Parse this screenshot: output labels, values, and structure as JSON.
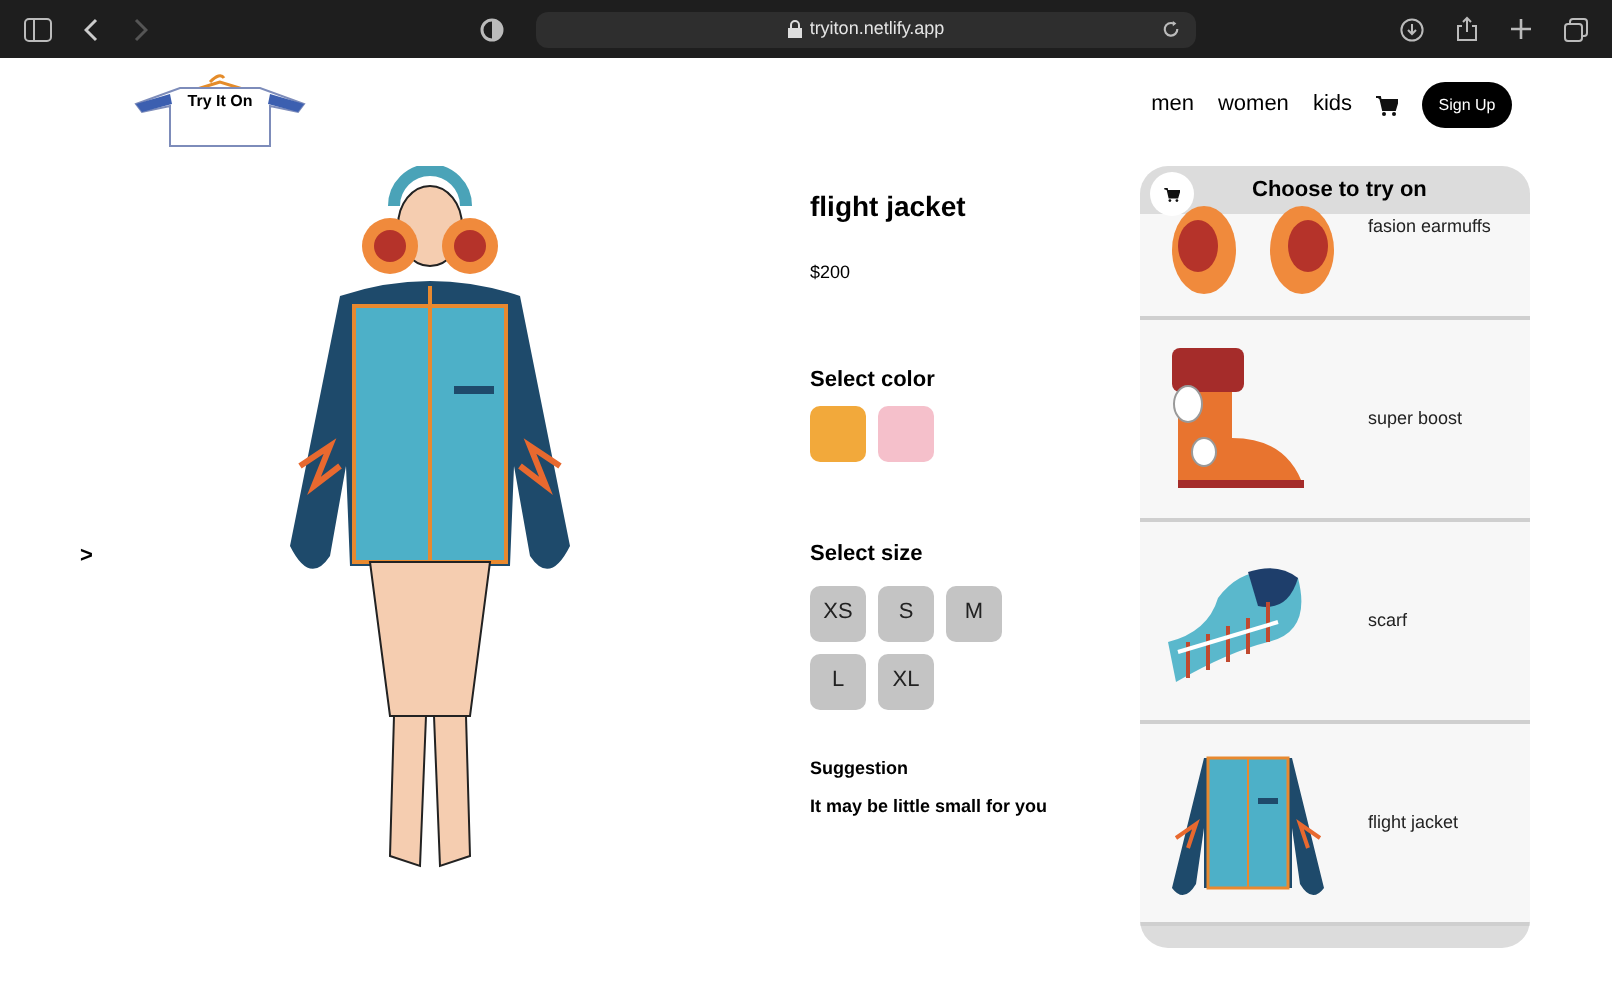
{
  "browser": {
    "url": "tryiton.netlify.app"
  },
  "logo": {
    "text": "Try It On"
  },
  "nav": {
    "links": [
      "men",
      "women",
      "kids"
    ],
    "signup": "Sign Up"
  },
  "carousel": {
    "next": ">"
  },
  "product": {
    "title": "flight jacket",
    "price": "$200",
    "color_heading": "Select color",
    "colors": [
      {
        "color": "#f2a93b"
      },
      {
        "color": "#f5c0cb"
      }
    ],
    "size_heading": "Select size",
    "sizes": [
      "XS",
      "S",
      "M",
      "L",
      "XL"
    ],
    "suggestion_heading": "Suggestion",
    "suggestion": "It may be little small for you"
  },
  "try_on_panel": {
    "title": "Choose to try on",
    "items": [
      {
        "kind": "earmuffs",
        "name": "fasion earmuffs"
      },
      {
        "kind": "boot",
        "name": "super boost"
      },
      {
        "kind": "scarf",
        "name": "scarf"
      },
      {
        "kind": "jacket",
        "name": "flight jacket"
      }
    ]
  }
}
